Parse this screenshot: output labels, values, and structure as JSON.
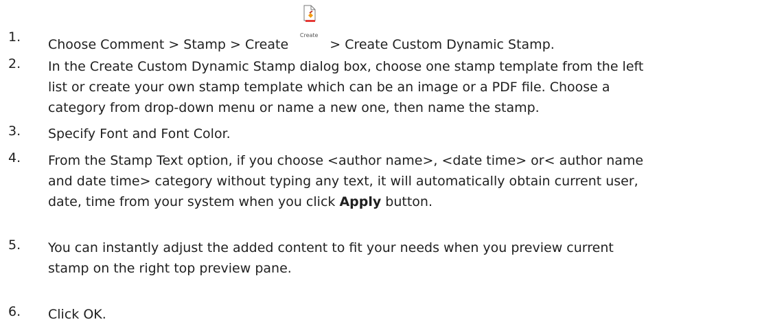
{
  "steps": [
    {
      "num": "1.",
      "before_icon": "Choose Comment > Stamp > Create",
      "icon": "create-stamp-icon",
      "icon_caption": "Create",
      "after_icon": "> Create Custom Dynamic Stamp."
    },
    {
      "num": "2.",
      "lines": [
        "In the Create Custom Dynamic Stamp dialog box, choose one stamp template from the left",
        "list or create your own stamp template which can be an image or a PDF file. Choose a",
        "category from drop-down menu or name a new one, then name the stamp."
      ]
    },
    {
      "num": "3.",
      "lines": [
        "Specify Font and Font Color."
      ]
    },
    {
      "num": "4.",
      "lines": [
        "From the Stamp Text option, if you choose <author name>, <date time> or< author name",
        "and date time> category without typing any text, it will automatically obtain current user,"
      ],
      "last_before": "date, time from your system when you click",
      "last_bold": "Apply",
      "last_after": "button."
    },
    {
      "num": "5.",
      "lines": [
        "You can instantly adjust the added content to fit your needs when you preview current",
        "stamp on the right top preview pane."
      ]
    },
    {
      "num": "6.",
      "lines": [
        "Click OK."
      ]
    }
  ]
}
